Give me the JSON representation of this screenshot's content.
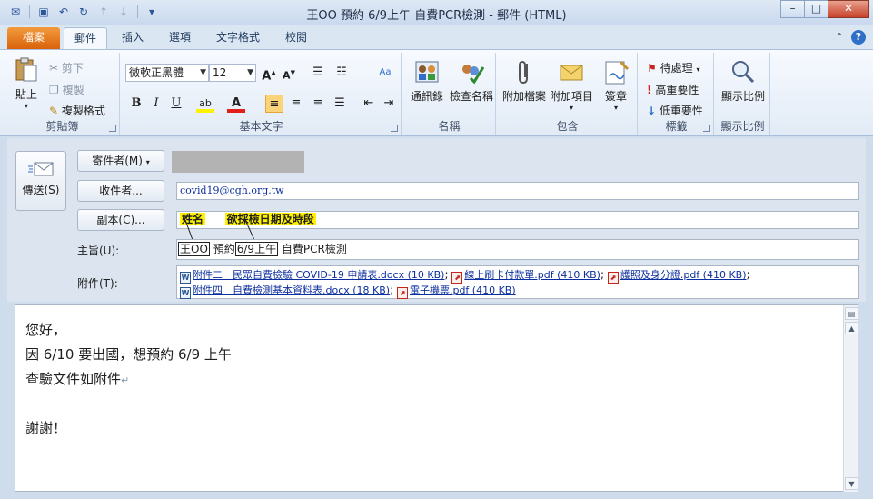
{
  "window": {
    "title": "王OO 預約 6/9上午 自費PCR檢測 - 郵件 (HTML)"
  },
  "tabs": {
    "file": "檔案",
    "items": [
      "郵件",
      "插入",
      "選項",
      "文字格式",
      "校閱"
    ]
  },
  "ribbon": {
    "clipboard": {
      "label": "剪貼簿",
      "paste": "貼上",
      "cut": "剪下",
      "copy": "複製",
      "format_painter": "複製格式"
    },
    "basic_text": {
      "label": "基本文字",
      "font": "微軟正黑體",
      "size": "12",
      "bold": "B",
      "italic": "I",
      "underline": "U"
    },
    "names": {
      "label": "名稱",
      "address_book": "通訊錄",
      "check_names": "檢查名稱"
    },
    "include": {
      "label": "包含",
      "attach_file": "附加檔案",
      "attach_item": "附加項目",
      "signature": "簽章"
    },
    "tags": {
      "label": "標籤",
      "follow_up": "待處理",
      "high_importance": "高重要性",
      "low_importance": "低重要性"
    },
    "zoom": {
      "label": "顯示比例",
      "zoom": "顯示比例"
    }
  },
  "form": {
    "send_label": "傳送(S)",
    "from_button": "寄件者(M)",
    "to_button": "收件者...",
    "cc_button": "副本(C)...",
    "subject_label": "主旨(U):",
    "attach_label": "附件(T):",
    "to_value": "covid19@cgh.org.tw",
    "cc_annotation_1": "姓名",
    "cc_annotation_2": "欲採檢日期及時段",
    "subject": {
      "name": "王OO",
      "mid": "預約",
      "date": "6/9上午",
      "rest": "自費PCR檢測"
    },
    "attachments": [
      {
        "type": "word",
        "name": "附件二　民眾自費檢驗 COVID-19 申請表.docx (10 KB)"
      },
      {
        "type": "pdf",
        "name": "線上刷卡付款單.pdf (410 KB)"
      },
      {
        "type": "pdf",
        "name": "護照及身分證.pdf (410 KB)"
      },
      {
        "type": "word",
        "name": "附件四　自費檢測基本資料表.docx (18 KB)"
      },
      {
        "type": "pdf",
        "name": "電子機票.pdf (410 KB)"
      }
    ]
  },
  "body": {
    "lines": [
      "您好，",
      "因 6/10 要出國，想預約 6/9 上午",
      "查驗文件如附件",
      "",
      "謝謝！"
    ]
  },
  "colors": {
    "file_tab": "#e16f0e",
    "highlight": "#fff200",
    "link": "#0b2f9e"
  },
  "icons": [
    "outlook-icon",
    "save-icon",
    "undo-icon",
    "redo-icon",
    "up-icon",
    "down-icon",
    "help-icon",
    "paste-icon",
    "scissors-icon",
    "copy-icon",
    "format-painter-icon",
    "address-book-icon",
    "check-names-icon",
    "paperclip-icon",
    "envelope-icon",
    "signature-icon",
    "flag-icon",
    "exclamation-icon",
    "down-arrow-icon",
    "magnifier-icon",
    "send-icon",
    "word-icon",
    "pdf-icon"
  ]
}
